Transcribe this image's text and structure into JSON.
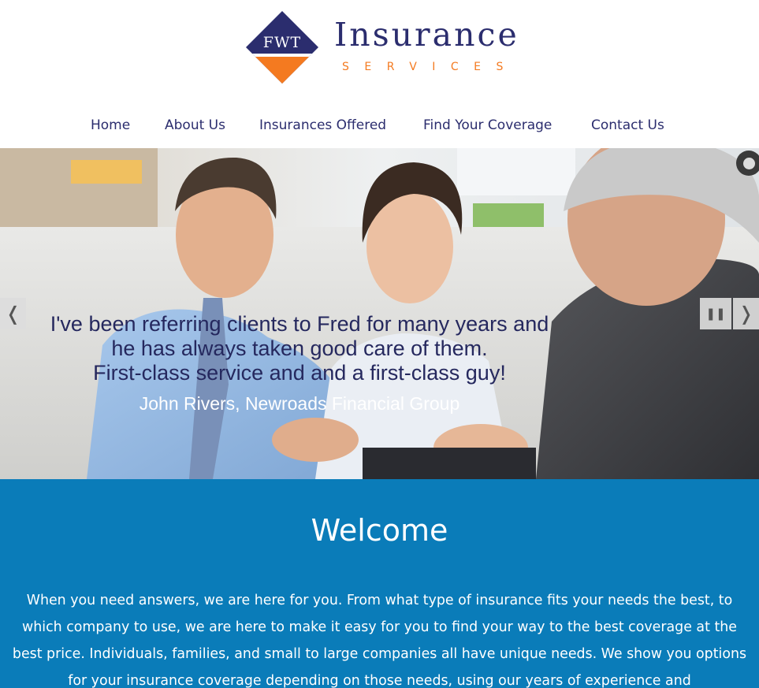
{
  "logo": {
    "abbr": "FWT",
    "word": "Insurance",
    "sub": "SERVICES",
    "colors": {
      "navy": "#2b2d6e",
      "orange": "#f47a20"
    }
  },
  "nav": {
    "items": [
      {
        "label": "Home"
      },
      {
        "label": "About Us"
      },
      {
        "label": "Insurances Offered"
      },
      {
        "label": "Find Your Coverage"
      },
      {
        "label": "Contact Us"
      }
    ]
  },
  "hero": {
    "quote_lines": [
      "I've been referring clients to Fred for many years and",
      "he has always taken good care of them.",
      "First-class service and and a first-class guy!"
    ],
    "author": "John Rivers, Newroads Financial Group",
    "controls": {
      "prev_icon": "chevron-left-icon",
      "pause_icon": "pause-icon",
      "next_icon": "chevron-right-icon",
      "indicator_icon": "slide-indicator-icon"
    }
  },
  "welcome": {
    "title": "Welcome",
    "text": "When you need answers, we are here for you. From what type of insurance fits your needs the best, to which company to use, we are here to make it easy for you to find your way to the best coverage at the best price. Individuals, families, and small to large companies all have unique needs. We show you options for your insurance coverage depending on those needs, using our years of experience and",
    "background": "#0a7cb9"
  }
}
